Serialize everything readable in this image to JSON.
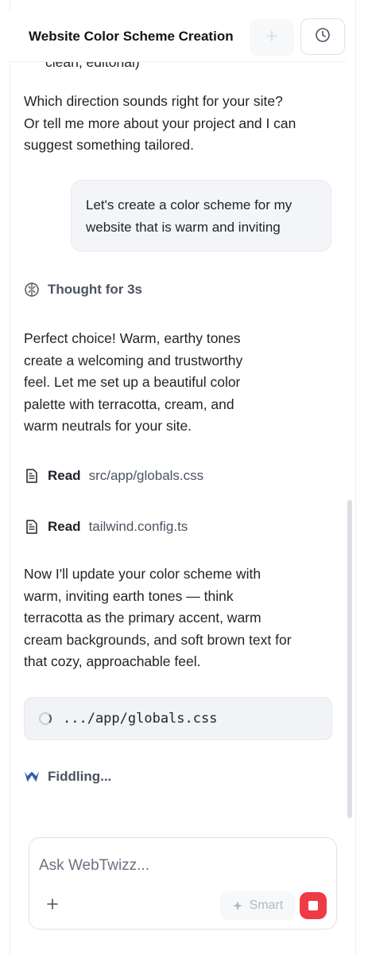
{
  "header": {
    "title": "Website Color Scheme Creation",
    "new_chat_icon": "plus-icon",
    "history_icon": "clock-icon"
  },
  "messages": {
    "cut_off_text": "clean, editorial)",
    "assistant_intro": "Which direction sounds right for your site? Or tell me more about your project and I can suggest something tailored.",
    "user_message": "Let's create a color scheme for my website that is warm and inviting",
    "thought_label": "Thought for 3s",
    "assistant_reply_1": "Perfect choice! Warm, earthy tones create a welcoming and trustworthy feel. Let me set up a beautiful color palette with terracotta, cream, and warm neutrals for your site.",
    "read_1": {
      "action": "Read",
      "file": "src/app/globals.css"
    },
    "read_2": {
      "action": "Read",
      "file": "tailwind.config.ts"
    },
    "assistant_reply_2": "Now I'll update your color scheme with warm, inviting earth tones — think terracotta as the primary accent, warm cream backgrounds, and soft brown text for that cozy, approachable feel.",
    "editing_file": ".../app/globals.css",
    "status": "Fiddling..."
  },
  "composer": {
    "placeholder": "Ask WebTwizz...",
    "add_icon": "plus-icon",
    "mode_label": "Smart",
    "mode_icon": "sparkle-icon",
    "stop_icon": "stop-icon"
  },
  "colors": {
    "stop_button": "#ef3b46",
    "logo_blue": "#2b5fb8",
    "bubble_bg": "#f3f5f8"
  }
}
